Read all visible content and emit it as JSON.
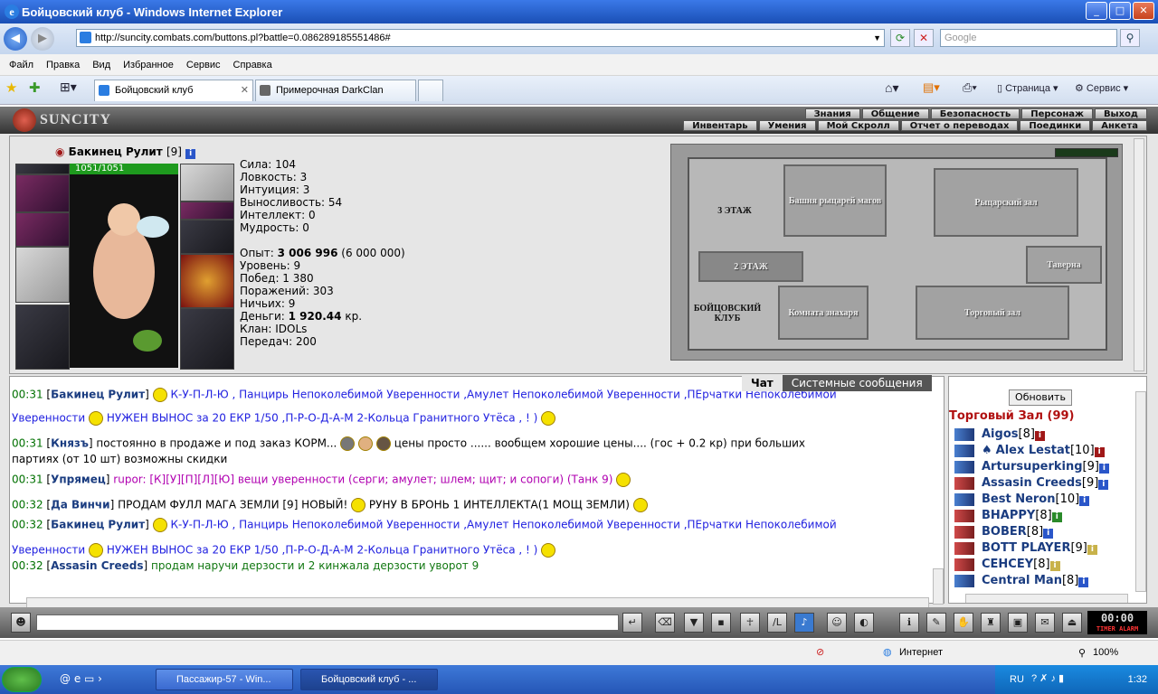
{
  "window": {
    "title": "Бойцовский клуб - Windows Internet Explorer"
  },
  "address": {
    "url": "http://suncity.combats.com/buttons.pl?battle=0.086289185551486#",
    "search_placeholder": "Google"
  },
  "menu": [
    "Файл",
    "Правка",
    "Вид",
    "Избранное",
    "Сервис",
    "Справка"
  ],
  "tabs": [
    {
      "label": "Бойцовский клуб"
    },
    {
      "label": "Примерочная DarkClan"
    }
  ],
  "toolbar": {
    "page": "Страница",
    "tools": "Сервис"
  },
  "game": {
    "logo": "SUNCITY",
    "nav1": [
      "Знания",
      "Общение",
      "Безопасность",
      "Персонаж",
      "Выход"
    ],
    "nav2": [
      "Инвентарь",
      "Умения",
      "Мой Скролл",
      "Отчет о переводах",
      "Поединки",
      "Анкета"
    ],
    "player": {
      "name": "Бакинец Рулит",
      "level": "[9]",
      "hp": "1051/1051"
    },
    "stats": [
      {
        "label": "Сила:",
        "value": "104"
      },
      {
        "label": "Ловкость:",
        "value": "3"
      },
      {
        "label": "Интуиция:",
        "value": "3"
      },
      {
        "label": "Выносливость:",
        "value": "54"
      },
      {
        "label": "Интеллект:",
        "value": "0"
      },
      {
        "label": "Мудрость:",
        "value": "0"
      }
    ],
    "info": {
      "exp_label": "Опыт:",
      "exp_value": "3 006 996",
      "exp_next": "(6 000 000)",
      "level": "Уровень: 9",
      "wins": "Побед: 1 380",
      "losses": "Поражений: 303",
      "draws": "Ничьих: 9",
      "money_label": "Деньги:",
      "money_value": "1 920.44",
      "money_unit": "кр.",
      "clan": "Клан: IDOLs",
      "transfers": "Передач: 200"
    },
    "map": {
      "floor3": "3 ЭТАЖ",
      "floor2": "2 ЭТАЖ",
      "club": "БОЙЦОВСКИЙ КЛУБ",
      "mage_tower": "Башня рыцарей магов",
      "knight_hall": "Рыцарский зал",
      "tavern": "Таверна",
      "healer": "Комната знахаря",
      "trade_hall": "Торговый зал"
    },
    "chat_tabs": [
      "Чат",
      "Системные сообщения"
    ],
    "chat": [
      {
        "time": "00:31",
        "nick": "Бакинец Рулит",
        "text": "К-У-П-Л-Ю , Панцирь Непоколебимой Уверенности ,Амулет Непоколебимой Уверенности ,ПЕрчатки Непоколебимой",
        "cont": "Уверенности",
        "text2": "НУЖЕН ВЫНОС за 20 ЕКР 1/50 ,П-Р-О-Д-А-М 2-Кольца Гранитного Утёса , ! )"
      },
      {
        "time": "00:31",
        "nick": "Князъ",
        "text": "постоянно в продаже и под заказ КОРМ...",
        "text2": "цены просто ...... вообщем хорошие цены.... (гос + 0.2 кр) при больших",
        "cont": "партиях (от 10 шт) возможны скидки"
      },
      {
        "time": "00:31",
        "nick": "Упрямец",
        "text": "rupor: [К][У][П][Л][Ю] вещи уверенности (серги; амулет; шлем; щит; и сопоги) (Танк 9)"
      },
      {
        "time": "00:32",
        "nick": "Да Винчи",
        "text": "ПРОДАМ ФУЛЛ МАГА ЗЕМЛИ [9] НОВЫЙ!",
        "text2": "РУНУ В БРОНЬ 1 ИНТЕЛЛЕКТА(1 МОЩ ЗЕМЛИ)"
      },
      {
        "time": "00:32",
        "nick": "Бакинец Рулит",
        "text": "К-У-П-Л-Ю , Панцирь Непоколебимой Уверенности ,Амулет Непоколебимой Уверенности ,ПЕрчатки Непоколебимой",
        "cont": "Уверенности",
        "text2": "НУЖЕН ВЫНОС за 20 ЕКР 1/50 ,П-Р-О-Д-А-М 2-Кольца Гранитного Утёса , ! )"
      },
      {
        "time": "00:32",
        "nick": "Assasin Creeds",
        "text": "продам наручи дерзости и 2 кинжала дерзости уворот 9"
      }
    ],
    "users": {
      "refresh": "Обновить",
      "room": "Торговый Зал (99)",
      "list": [
        {
          "name": "Aigos",
          "lvl": "[8]"
        },
        {
          "name": "Alex Lestat",
          "lvl": "[10]"
        },
        {
          "name": "Artursuperking",
          "lvl": "[9]"
        },
        {
          "name": "Assasin Creeds",
          "lvl": "[9]"
        },
        {
          "name": "Best Neron",
          "lvl": "[10]"
        },
        {
          "name": "BHAPPY",
          "lvl": "[8]"
        },
        {
          "name": "BOBER",
          "lvl": "[8]"
        },
        {
          "name": "BOTT PLAYER",
          "lvl": "[9]"
        },
        {
          "name": "CEHCEY",
          "lvl": "[8]"
        },
        {
          "name": "Central Man",
          "lvl": "[8]"
        }
      ]
    },
    "timer": {
      "text": "00:00",
      "label": "TIMER ALARM"
    }
  },
  "status": {
    "zone": "Интернет",
    "zoom": "100%"
  },
  "taskbar": {
    "items": [
      "Пассажир-57 - Win...",
      "Бойцовский клуб - ..."
    ],
    "lang": "RU",
    "clock": "1:32"
  }
}
